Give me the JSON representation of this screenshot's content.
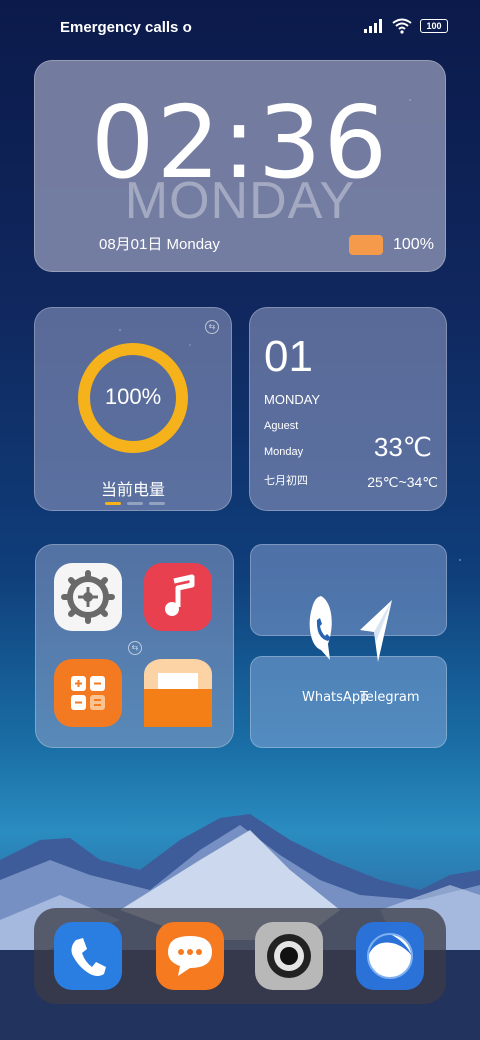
{
  "status_bar": {
    "carrier_text": "Emergency calls o",
    "battery_level": "100",
    "icons": [
      "signal-icon",
      "wifi-icon",
      "battery-icon"
    ]
  },
  "clock_widget": {
    "time": "02:36",
    "day_watermark": "MONDAY",
    "date": "08月01日 Monday",
    "battery_percent": "100%",
    "battery_swatch_color": "#f59a4a"
  },
  "battery_widget": {
    "percent": "100%",
    "label": "当前电量",
    "ring_color": "#f6b21a"
  },
  "date_widget": {
    "day_number": "01",
    "weekday_caps": "MONDAY",
    "month": "Aguest",
    "weekday": "Monday",
    "lunar_date": "七月初四",
    "temperature": "33℃",
    "temperature_range": "25℃~34℃"
  },
  "folder": {
    "apps": [
      {
        "name": "settings",
        "icon": "gear-icon",
        "color": "#f5f5f5"
      },
      {
        "name": "music",
        "icon": "music-note-icon",
        "color": "#e8404f"
      },
      {
        "name": "calculator",
        "icon": "calculator-icon",
        "color": "#f47a21"
      },
      {
        "name": "notes",
        "icon": "notes-icon",
        "color": "#f57f17"
      }
    ]
  },
  "shortcuts": {
    "whatsapp_label": "WhatsApp",
    "telegram_label": "Telegram"
  },
  "dock": {
    "apps": [
      {
        "name": "phone",
        "icon": "phone-icon",
        "color": "#2a7de1"
      },
      {
        "name": "messages",
        "icon": "chat-bubble-icon",
        "color": "#f57a20"
      },
      {
        "name": "camera",
        "icon": "camera-icon",
        "color": "#b8b8b8"
      },
      {
        "name": "browser",
        "icon": "browser-icon",
        "color": "#2a72d8"
      }
    ]
  }
}
